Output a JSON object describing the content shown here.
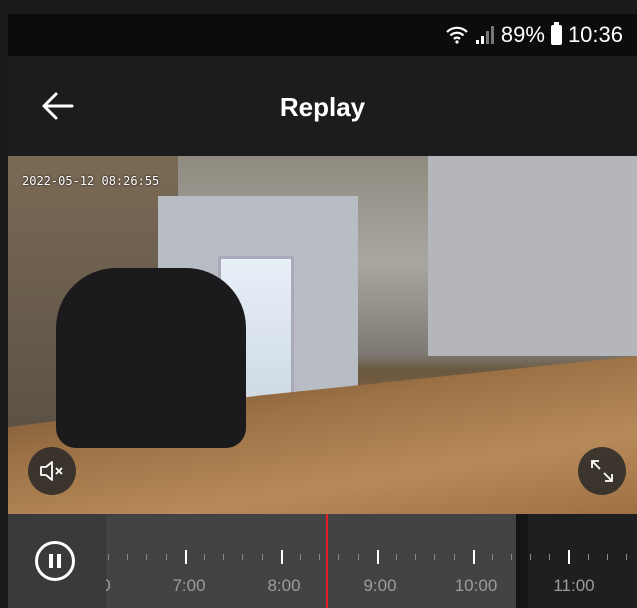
{
  "status": {
    "battery": "89%",
    "time": "10:36"
  },
  "header": {
    "title": "Replay",
    "back_icon": "arrow-left-icon"
  },
  "video": {
    "timestamp": "2022-05-12 08:26:55",
    "mute_icon": "speaker-muted-icon",
    "fullscreen_icon": "expand-icon"
  },
  "timeline": {
    "pause_icon": "pause-icon",
    "labels": [
      "0",
      "7:00",
      "8:00",
      "9:00",
      "10:00",
      "11:00"
    ],
    "accent": "#e02020"
  }
}
